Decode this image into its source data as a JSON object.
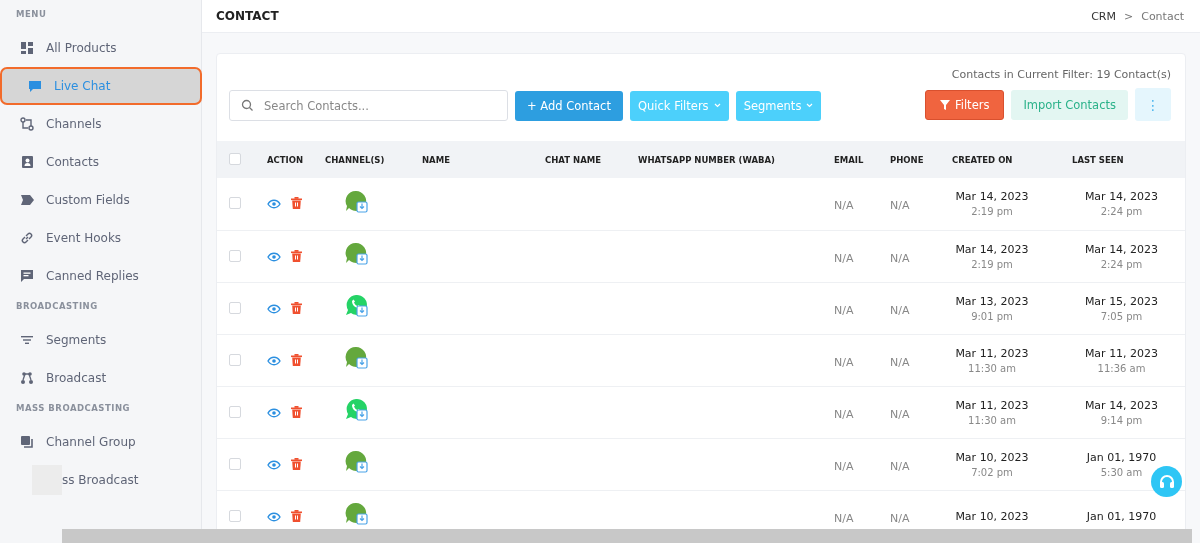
{
  "sidebar": {
    "sections": [
      {
        "heading": "MENU",
        "items": [
          {
            "label": "All Products",
            "kind": "grid",
            "selected": false
          },
          {
            "label": "Live Chat",
            "kind": "chat",
            "selected": true
          },
          {
            "label": "Channels",
            "kind": "route",
            "selected": false
          },
          {
            "label": "Contacts",
            "kind": "contact",
            "selected": false
          },
          {
            "label": "Custom Fields",
            "kind": "tag",
            "selected": false
          },
          {
            "label": "Event Hooks",
            "kind": "link",
            "selected": false
          },
          {
            "label": "Canned Replies",
            "kind": "message",
            "selected": false
          }
        ]
      },
      {
        "heading": "BROADCASTING",
        "items": [
          {
            "label": "Segments",
            "kind": "filter",
            "selected": false
          },
          {
            "label": "Broadcast",
            "kind": "nodes",
            "selected": false
          }
        ]
      },
      {
        "heading": "MASS BROADCASTING",
        "items": [
          {
            "label": "Channel Group",
            "kind": "stack",
            "selected": false
          },
          {
            "label": "ss Broadcast",
            "kind": "covered",
            "selected": false
          }
        ]
      }
    ]
  },
  "header": {
    "title": "CONTACT",
    "breadcrumbs": [
      "CRM",
      "Contact"
    ],
    "separator": ">"
  },
  "toolbar": {
    "count_text": "Contacts in Current Filter: 19 Contact(s)",
    "search": {
      "placeholder": "Search Contacts..."
    },
    "buttons": [
      {
        "label": "+  Add Contact",
        "kind": "primary"
      },
      {
        "label": "Quick Filters",
        "kind": "dropdown"
      },
      {
        "label": "Segments",
        "kind": "dropdown"
      }
    ],
    "right_buttons": [
      {
        "label": "Filters",
        "kind": "danger"
      },
      {
        "label": "Import Contacts",
        "kind": "soft"
      },
      {
        "label": "⋮",
        "kind": "more"
      }
    ]
  },
  "table": {
    "select_all_checked": false,
    "columns": [
      "ACTION",
      "CHANNEL(S)",
      "NAME",
      "CHAT NAME",
      "WHATSAPP NUMBER (WABA)",
      "EMAIL",
      "PHONE",
      "CREATED ON",
      "LAST SEEN"
    ],
    "rows": [
      {
        "checked": false,
        "kind": "bubble",
        "email": "N/A",
        "phone": "N/A",
        "created_date": "Mar 14, 2023",
        "created_time": "2:19 pm",
        "seen_date": "Mar 14, 2023",
        "seen_time": "2:24 pm"
      },
      {
        "checked": false,
        "kind": "bubble",
        "email": "N/A",
        "phone": "N/A",
        "created_date": "Mar 14, 2023",
        "created_time": "2:19 pm",
        "seen_date": "Mar 14, 2023",
        "seen_time": "2:24 pm"
      },
      {
        "checked": false,
        "kind": "whatsapp",
        "email": "N/A",
        "phone": "N/A",
        "created_date": "Mar 13, 2023",
        "created_time": "9:01 pm",
        "seen_date": "Mar 15, 2023",
        "seen_time": "7:05 pm"
      },
      {
        "checked": false,
        "kind": "bubble",
        "email": "N/A",
        "phone": "N/A",
        "created_date": "Mar 11, 2023",
        "created_time": "11:30 am",
        "seen_date": "Mar 11, 2023",
        "seen_time": "11:36 am"
      },
      {
        "checked": false,
        "kind": "whatsapp",
        "email": "N/A",
        "phone": "N/A",
        "created_date": "Mar 11, 2023",
        "created_time": "11:30 am",
        "seen_date": "Mar 14, 2023",
        "seen_time": "9:14 pm"
      },
      {
        "checked": false,
        "kind": "bubble",
        "email": "N/A",
        "phone": "N/A",
        "created_date": "Mar 10, 2023",
        "created_time": "7:02 pm",
        "seen_date": "Jan 01, 1970",
        "seen_time": "5:30 am"
      },
      {
        "checked": false,
        "kind": "bubble",
        "email": "N/A",
        "phone": "N/A",
        "created_date": "Mar 10, 2023",
        "seen_date": "Jan 01, 1970"
      }
    ]
  }
}
